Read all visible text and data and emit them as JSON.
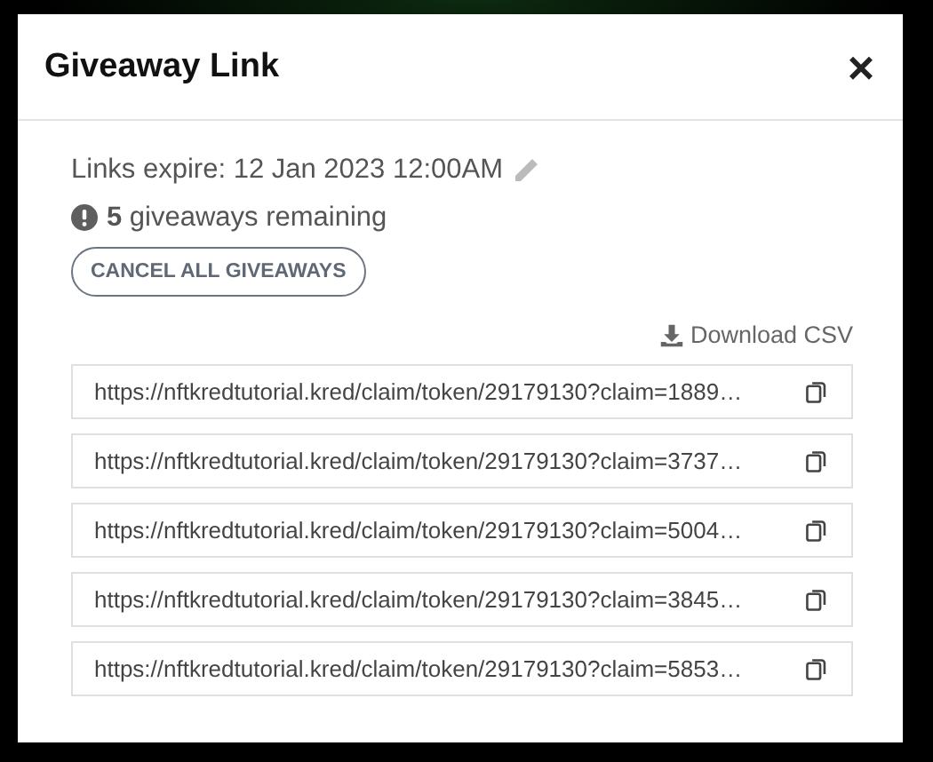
{
  "dialog": {
    "title": "Giveaway Link",
    "close": "×"
  },
  "expiry": "Links expire: 12 Jan 2023 12:00AM",
  "remaining": "**5** giveaways remaining",
  "cancel_button": "CANCEL ALL GIVEAWAYS",
  "download": "Download CSV",
  "links": [
    {
      "url": "https://nftkredtutorial.kred/claim/token/29179130?claim=1889…"
    },
    {
      "url": "https://nftkredtutorial.kred/claim/token/29179130?claim=3737…"
    },
    {
      "url": "https://nftkredtutorial.kred/claim/token/29179130?claim=5004…"
    },
    {
      "url": "https://nftkredtutorial.kred/claim/token/29179130?claim=3845…"
    },
    {
      "url": "https://nftkredtutorial.kred/claim/token/29179130?claim=5853…"
    }
  ]
}
